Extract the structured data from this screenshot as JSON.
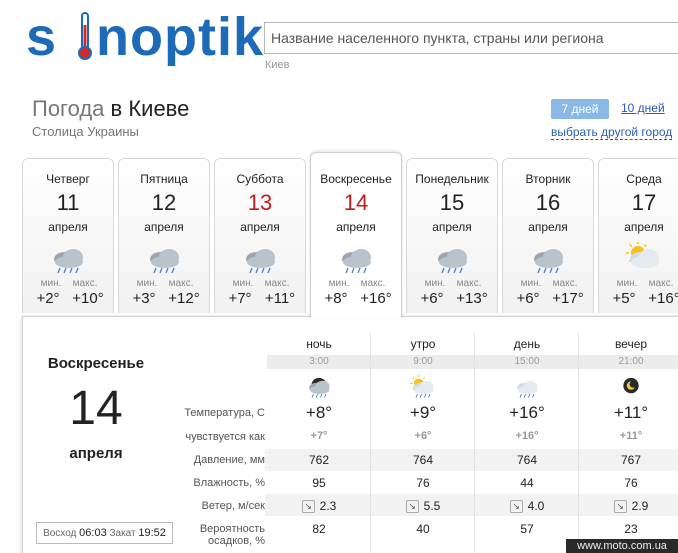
{
  "logo": {
    "text_left": "s",
    "text_right": "noptik"
  },
  "search": {
    "placeholder": "Название населенного пункта, страны или региона",
    "hint": "Киев"
  },
  "header": {
    "title_prefix": "Погода",
    "title_city": "в Киеве",
    "subtitle": "Столица Украины",
    "tab_7": "7 дней",
    "tab_10": "10 дней",
    "choose_city": "выбрать другой город"
  },
  "days": [
    {
      "name": "Четверг",
      "num": "11",
      "month": "апреля",
      "min_label": "мин.",
      "max_label": "макс.",
      "min": "+2°",
      "max": "+10°",
      "icon": "cloud-rain-icon",
      "weekend": false
    },
    {
      "name": "Пятница",
      "num": "12",
      "month": "апреля",
      "min_label": "мин.",
      "max_label": "макс.",
      "min": "+3°",
      "max": "+12°",
      "icon": "cloud-rain-icon",
      "weekend": false
    },
    {
      "name": "Суббота",
      "num": "13",
      "month": "апреля",
      "min_label": "мин.",
      "max_label": "макс.",
      "min": "+7°",
      "max": "+11°",
      "icon": "cloud-rain-icon",
      "weekend": true
    },
    {
      "name": "Воскресенье",
      "num": "14",
      "month": "апреля",
      "min_label": "мин.",
      "max_label": "макс.",
      "min": "+8°",
      "max": "+16°",
      "icon": "cloud-rain-icon",
      "weekend": true
    },
    {
      "name": "Понедельник",
      "num": "15",
      "month": "апреля",
      "min_label": "мин.",
      "max_label": "макс.",
      "min": "+6°",
      "max": "+13°",
      "icon": "cloud-rain-icon",
      "weekend": false
    },
    {
      "name": "Вторник",
      "num": "16",
      "month": "апреля",
      "min_label": "мин.",
      "max_label": "макс.",
      "min": "+6°",
      "max": "+17°",
      "icon": "cloud-rain-icon",
      "weekend": false
    },
    {
      "name": "Среда",
      "num": "17",
      "month": "апреля",
      "min_label": "мин.",
      "max_label": "макс.",
      "min": "+5°",
      "max": "+16°",
      "icon": "sun-cloud-icon",
      "weekend": false
    }
  ],
  "detail": {
    "day_name": "Воскресенье",
    "day_num": "14",
    "month": "апреля",
    "sunrise_label": "Восход",
    "sunrise": "06:03",
    "sunset_label": "Закат",
    "sunset": "19:52",
    "periods": [
      {
        "name": "ночь",
        "hour": "3:00",
        "icon": "night-rain-cloud-icon",
        "temp": "+8°",
        "feels": "+7°",
        "pressure": "762",
        "humidity": "95",
        "wind": "2.3",
        "precip": "82"
      },
      {
        "name": "утро",
        "hour": "9:00",
        "icon": "sun-cloud-rain-icon",
        "temp": "+9°",
        "feels": "+6°",
        "pressure": "764",
        "humidity": "76",
        "wind": "5.5",
        "precip": "40"
      },
      {
        "name": "день",
        "hour": "15:00",
        "icon": "cloud-light-rain-icon",
        "temp": "+16°",
        "feels": "+16°",
        "pressure": "764",
        "humidity": "44",
        "wind": "4.0",
        "precip": "57"
      },
      {
        "name": "вечер",
        "hour": "21:00",
        "icon": "moon-cloud-icon",
        "temp": "+11°",
        "feels": "+11°",
        "pressure": "767",
        "humidity": "76",
        "wind": "2.9",
        "precip": "23"
      }
    ],
    "labels": {
      "temp": "Температура, С",
      "feels": "чувствуется как",
      "pressure": "Давление, мм",
      "humidity": "Влажность, %",
      "wind": "Ветер, м/сек",
      "precip_1": "Вероятность",
      "precip_2": "осадков, %"
    }
  },
  "credit": "www.moto.com.ua",
  "colors": {
    "brand": "#1d6ab8",
    "weekend": "#c21c1c",
    "link": "#2a5db0",
    "active_tab": "#8ab8e4"
  }
}
